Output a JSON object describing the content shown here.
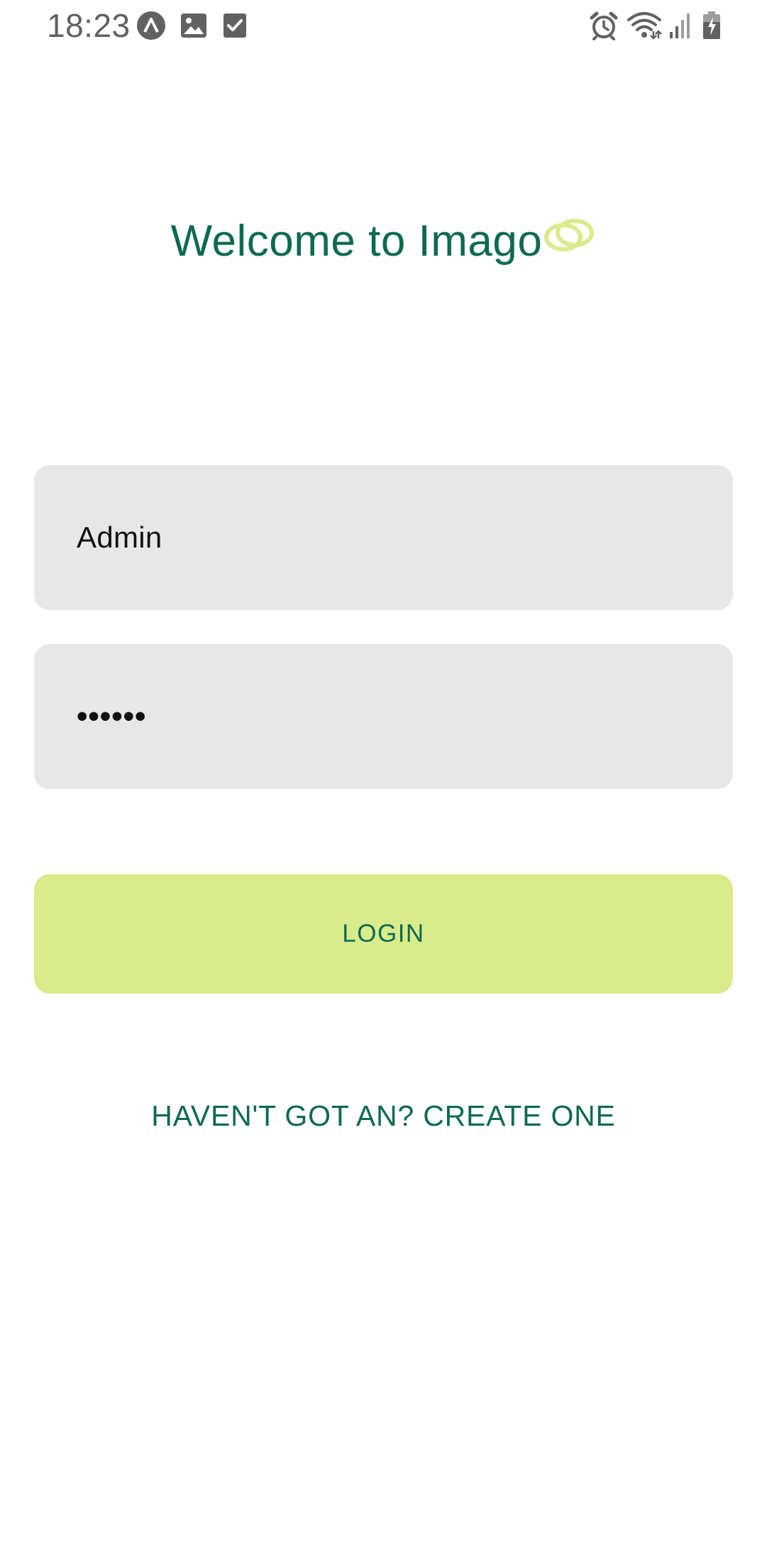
{
  "status_bar": {
    "time": "18:23",
    "left_icons": [
      "expo-icon",
      "image-icon",
      "checkbox-icon"
    ],
    "right_icons": [
      "alarm-icon",
      "wifi-icon",
      "signal-icon",
      "battery-charging-icon"
    ]
  },
  "login": {
    "title": "Welcome to Imago",
    "logo_icon": "interlocking-rings-logo",
    "username_value": "Admin",
    "password_value": "••••••",
    "login_label": "LOGIN",
    "create_account_label": "HAVEN'T GOT AN? CREATE ONE"
  },
  "colors": {
    "brand_green": "#0d6a52",
    "accent_lime": "#d9eb8a",
    "field_bg": "#e7e7e7",
    "status_gray": "#616161"
  }
}
